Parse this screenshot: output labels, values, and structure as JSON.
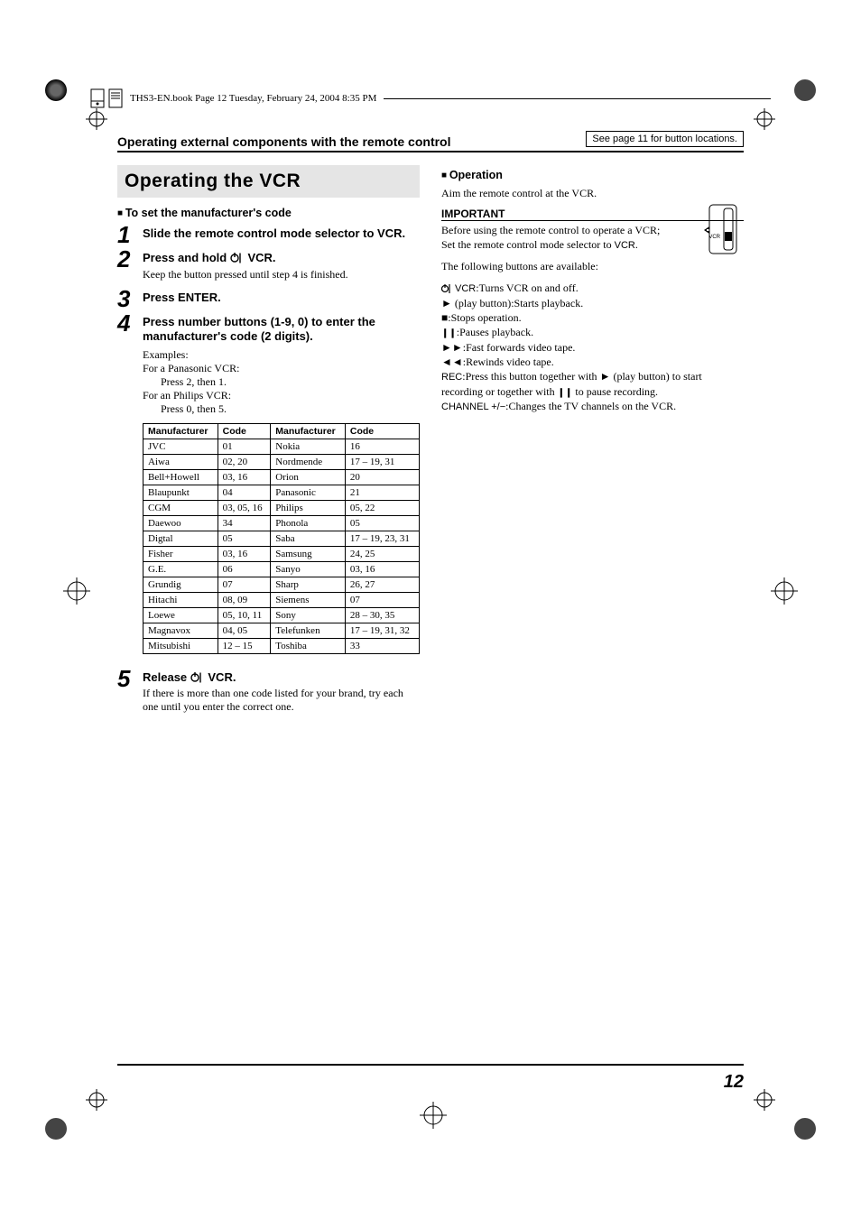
{
  "bookline": "THS3-EN.book  Page 12  Tuesday, February 24, 2004  8:35 PM",
  "header": {
    "title": "Operating external components with the remote control",
    "note": "See page 11 for button locations."
  },
  "left": {
    "title": "Operating the VCR",
    "setCode": "To set the manufacturer's code",
    "steps": {
      "1": {
        "title": "Slide the remote control mode selector to VCR."
      },
      "2": {
        "title_pre": "Press and hold ",
        "title_post": " VCR.",
        "para": "Keep the button pressed until step 4 is finished."
      },
      "3": {
        "title": "Press ENTER."
      },
      "4": {
        "title": "Press number buttons (1-9, 0) to enter the manufacturer's code (2 digits)."
      },
      "5": {
        "title_pre": "Release ",
        "title_post": " VCR.",
        "para": "If there is more than one code listed for your brand, try each one until you enter the correct one."
      }
    },
    "examples": {
      "heading": "Examples:",
      "pana": "For a Panasonic VCR:",
      "pana_code_a": "2",
      "pana_code_b": "1",
      "philips": "For an Philips VCR:",
      "philips_code_a": "0",
      "philips_code_b": "5"
    },
    "table": {
      "headers": [
        "Manufac­turer",
        "Code",
        "Manufac­turer",
        "Code"
      ],
      "rows": [
        [
          "JVC",
          "01",
          "Nokia",
          "16"
        ],
        [
          "Aiwa",
          "02, 20",
          "Nordmende",
          "17 – 19, 31"
        ],
        [
          "Bell+Howell",
          "03, 16",
          "Orion",
          "20"
        ],
        [
          "Blaupunkt",
          "04",
          "Panasonic",
          "21"
        ],
        [
          "CGM",
          "03, 05, 16",
          "Philips",
          "05, 22"
        ],
        [
          "Daewoo",
          "34",
          "Phonola",
          "05"
        ],
        [
          "Digtal",
          "05",
          "Saba",
          "17 – 19, 23, 31"
        ],
        [
          "Fisher",
          "03, 16",
          "Samsung",
          "24, 25"
        ],
        [
          "G.E.",
          "06",
          "Sanyo",
          "03, 16"
        ],
        [
          "Grundig",
          "07",
          "Sharp",
          "26, 27"
        ],
        [
          "Hitachi",
          "08, 09",
          "Siemens",
          "07"
        ],
        [
          "Loewe",
          "05, 10, 11",
          "Sony",
          "28 – 30, 35"
        ],
        [
          "Magnavox",
          "04, 05",
          "Telefunken",
          "17 – 19, 31, 32"
        ],
        [
          "Mitsubishi",
          "12 – 15",
          "Toshiba",
          "33"
        ]
      ]
    }
  },
  "right": {
    "operation_label": "Operation",
    "aim": "Aim the remote control at the VCR.",
    "important": "IMPORTANT",
    "before1": "Before using the remote control to operate a VCR;",
    "before2_pre": "Set the remote control mode selector to ",
    "before2_post": "VCR",
    "following": "The following buttons are available:",
    "vcr_on": ":Turns VCR on and off.",
    "play": " (play button):Starts playback.",
    "stop": ":Stops operation.",
    "pause": ":Pauses playback.",
    "ff": ":Fast forwards video tape.",
    "rew": ":Rewinds video tape.",
    "rec_label": "REC",
    "rec_text": ":Press this button together with ",
    "rec_text2": " (play button) to start recording or together with ",
    "rec_text3": " to pause recording.",
    "channel_label": "CHANNEL +/−",
    "channel_text": ":Changes the TV channels on the VCR.",
    "vcr_label": "VCR",
    "selector_text": "VCR"
  },
  "page_num": "12"
}
